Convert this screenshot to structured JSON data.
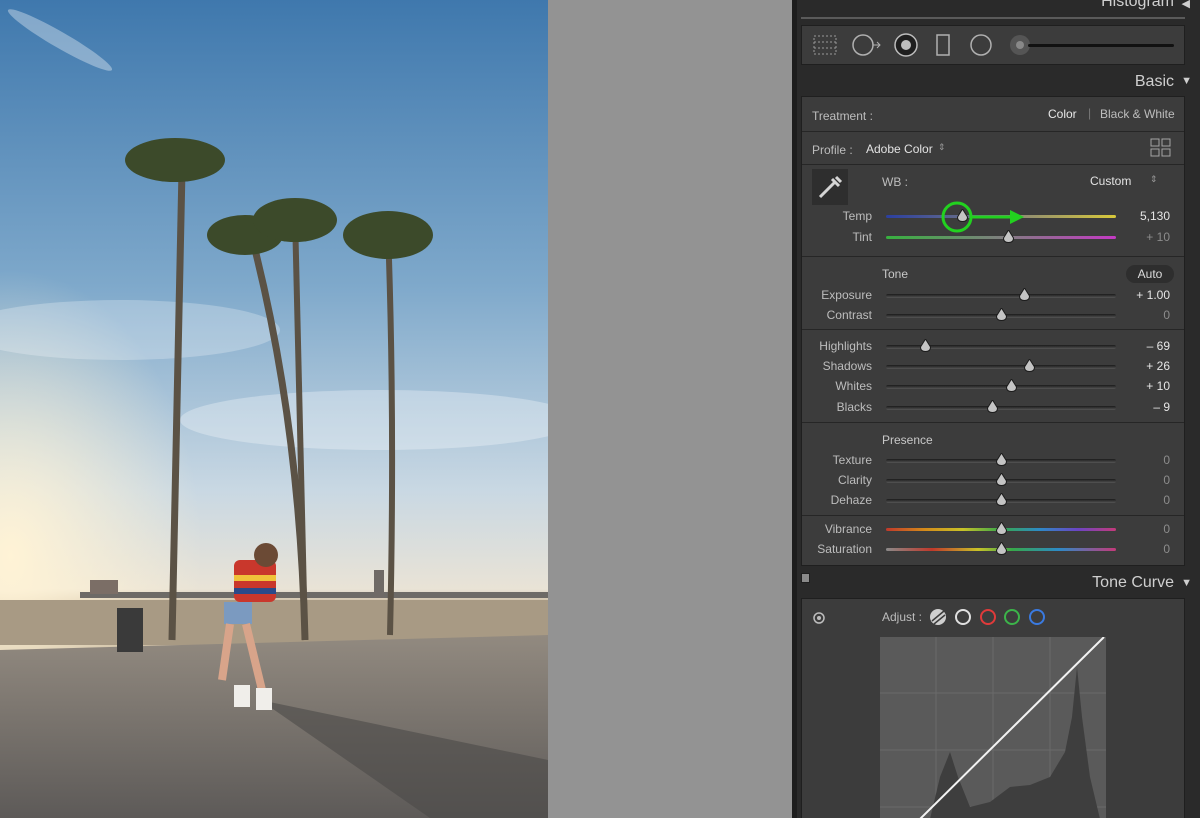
{
  "panel": {
    "histogram_title": "Histogram",
    "basic": {
      "title": "Basic",
      "treatment_label": "Treatment :",
      "treatment_color": "Color",
      "treatment_bw": "Black & White",
      "profile_label": "Profile :",
      "profile_value": "Adobe Color",
      "wb_label": "WB :",
      "wb_value": "Custom",
      "tone_label": "Tone",
      "auto_label": "Auto",
      "presence_label": "Presence",
      "sliders": [
        {
          "label": "Temp",
          "value": "5,130",
          "dim": false,
          "pos": 0.33,
          "track": "temp"
        },
        {
          "label": "Tint",
          "value": "+ 10",
          "dim": true,
          "pos": 0.53,
          "track": "tint"
        },
        {
          "label": "Exposure",
          "value": "+ 1.00",
          "dim": false,
          "pos": 0.6,
          "track": "gray"
        },
        {
          "label": "Contrast",
          "value": "0",
          "dim": true,
          "pos": 0.5,
          "track": "gray"
        },
        {
          "label": "Highlights",
          "value": "– 69",
          "dim": false,
          "pos": 0.17,
          "track": "gray"
        },
        {
          "label": "Shadows",
          "value": "+ 26",
          "dim": false,
          "pos": 0.62,
          "track": "gray"
        },
        {
          "label": "Whites",
          "value": "+ 10",
          "dim": false,
          "pos": 0.545,
          "track": "gray"
        },
        {
          "label": "Blacks",
          "value": "– 9",
          "dim": false,
          "pos": 0.46,
          "track": "gray"
        },
        {
          "label": "Texture",
          "value": "0",
          "dim": true,
          "pos": 0.5,
          "track": "gray"
        },
        {
          "label": "Clarity",
          "value": "0",
          "dim": true,
          "pos": 0.5,
          "track": "gray"
        },
        {
          "label": "Dehaze",
          "value": "0",
          "dim": true,
          "pos": 0.5,
          "track": "gray"
        },
        {
          "label": "Vibrance",
          "value": "0",
          "dim": true,
          "pos": 0.5,
          "track": "vib"
        },
        {
          "label": "Saturation",
          "value": "0",
          "dim": true,
          "pos": 0.5,
          "track": "sat"
        }
      ]
    },
    "tone_curve": {
      "title": "Tone Curve",
      "adjust_label": "Adjust :",
      "channels": [
        "parametric-icon",
        "rgb-channel-icon",
        "red-channel-icon",
        "green-channel-icon",
        "blue-channel-icon"
      ]
    },
    "tools": [
      "crop-overlay-icon",
      "spot-removal-icon",
      "red-eye-icon",
      "graduated-filter-icon",
      "radial-filter-icon",
      "adjustment-brush-icon"
    ],
    "colors": {
      "annotation": "#22d11f",
      "panel": "#3c3c3c"
    }
  }
}
